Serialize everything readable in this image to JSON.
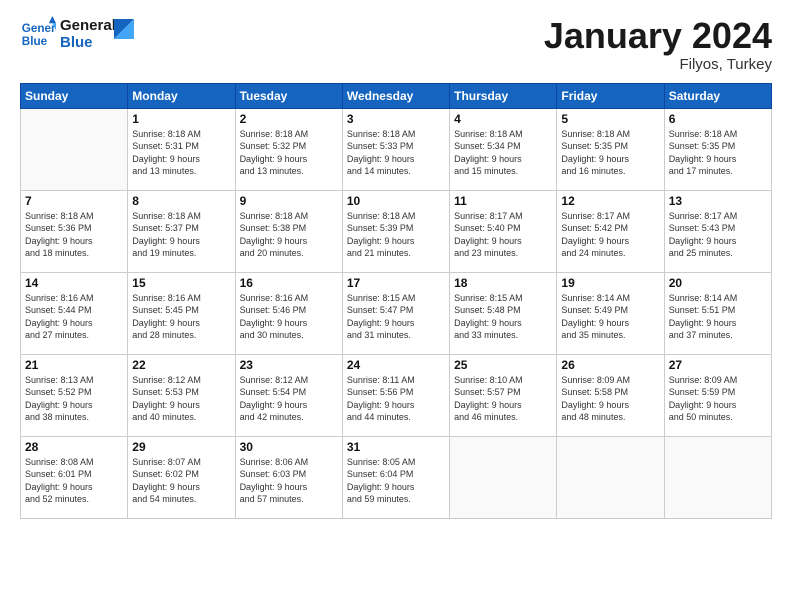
{
  "logo": {
    "line1": "General",
    "line2": "Blue"
  },
  "title": "January 2024",
  "subtitle": "Filyos, Turkey",
  "header_days": [
    "Sunday",
    "Monday",
    "Tuesday",
    "Wednesday",
    "Thursday",
    "Friday",
    "Saturday"
  ],
  "weeks": [
    [
      {
        "day": "",
        "info": ""
      },
      {
        "day": "1",
        "info": "Sunrise: 8:18 AM\nSunset: 5:31 PM\nDaylight: 9 hours\nand 13 minutes."
      },
      {
        "day": "2",
        "info": "Sunrise: 8:18 AM\nSunset: 5:32 PM\nDaylight: 9 hours\nand 13 minutes."
      },
      {
        "day": "3",
        "info": "Sunrise: 8:18 AM\nSunset: 5:33 PM\nDaylight: 9 hours\nand 14 minutes."
      },
      {
        "day": "4",
        "info": "Sunrise: 8:18 AM\nSunset: 5:34 PM\nDaylight: 9 hours\nand 15 minutes."
      },
      {
        "day": "5",
        "info": "Sunrise: 8:18 AM\nSunset: 5:35 PM\nDaylight: 9 hours\nand 16 minutes."
      },
      {
        "day": "6",
        "info": "Sunrise: 8:18 AM\nSunset: 5:35 PM\nDaylight: 9 hours\nand 17 minutes."
      }
    ],
    [
      {
        "day": "7",
        "info": "Sunrise: 8:18 AM\nSunset: 5:36 PM\nDaylight: 9 hours\nand 18 minutes."
      },
      {
        "day": "8",
        "info": "Sunrise: 8:18 AM\nSunset: 5:37 PM\nDaylight: 9 hours\nand 19 minutes."
      },
      {
        "day": "9",
        "info": "Sunrise: 8:18 AM\nSunset: 5:38 PM\nDaylight: 9 hours\nand 20 minutes."
      },
      {
        "day": "10",
        "info": "Sunrise: 8:18 AM\nSunset: 5:39 PM\nDaylight: 9 hours\nand 21 minutes."
      },
      {
        "day": "11",
        "info": "Sunrise: 8:17 AM\nSunset: 5:40 PM\nDaylight: 9 hours\nand 23 minutes."
      },
      {
        "day": "12",
        "info": "Sunrise: 8:17 AM\nSunset: 5:42 PM\nDaylight: 9 hours\nand 24 minutes."
      },
      {
        "day": "13",
        "info": "Sunrise: 8:17 AM\nSunset: 5:43 PM\nDaylight: 9 hours\nand 25 minutes."
      }
    ],
    [
      {
        "day": "14",
        "info": "Sunrise: 8:16 AM\nSunset: 5:44 PM\nDaylight: 9 hours\nand 27 minutes."
      },
      {
        "day": "15",
        "info": "Sunrise: 8:16 AM\nSunset: 5:45 PM\nDaylight: 9 hours\nand 28 minutes."
      },
      {
        "day": "16",
        "info": "Sunrise: 8:16 AM\nSunset: 5:46 PM\nDaylight: 9 hours\nand 30 minutes."
      },
      {
        "day": "17",
        "info": "Sunrise: 8:15 AM\nSunset: 5:47 PM\nDaylight: 9 hours\nand 31 minutes."
      },
      {
        "day": "18",
        "info": "Sunrise: 8:15 AM\nSunset: 5:48 PM\nDaylight: 9 hours\nand 33 minutes."
      },
      {
        "day": "19",
        "info": "Sunrise: 8:14 AM\nSunset: 5:49 PM\nDaylight: 9 hours\nand 35 minutes."
      },
      {
        "day": "20",
        "info": "Sunrise: 8:14 AM\nSunset: 5:51 PM\nDaylight: 9 hours\nand 37 minutes."
      }
    ],
    [
      {
        "day": "21",
        "info": "Sunrise: 8:13 AM\nSunset: 5:52 PM\nDaylight: 9 hours\nand 38 minutes."
      },
      {
        "day": "22",
        "info": "Sunrise: 8:12 AM\nSunset: 5:53 PM\nDaylight: 9 hours\nand 40 minutes."
      },
      {
        "day": "23",
        "info": "Sunrise: 8:12 AM\nSunset: 5:54 PM\nDaylight: 9 hours\nand 42 minutes."
      },
      {
        "day": "24",
        "info": "Sunrise: 8:11 AM\nSunset: 5:56 PM\nDaylight: 9 hours\nand 44 minutes."
      },
      {
        "day": "25",
        "info": "Sunrise: 8:10 AM\nSunset: 5:57 PM\nDaylight: 9 hours\nand 46 minutes."
      },
      {
        "day": "26",
        "info": "Sunrise: 8:09 AM\nSunset: 5:58 PM\nDaylight: 9 hours\nand 48 minutes."
      },
      {
        "day": "27",
        "info": "Sunrise: 8:09 AM\nSunset: 5:59 PM\nDaylight: 9 hours\nand 50 minutes."
      }
    ],
    [
      {
        "day": "28",
        "info": "Sunrise: 8:08 AM\nSunset: 6:01 PM\nDaylight: 9 hours\nand 52 minutes."
      },
      {
        "day": "29",
        "info": "Sunrise: 8:07 AM\nSunset: 6:02 PM\nDaylight: 9 hours\nand 54 minutes."
      },
      {
        "day": "30",
        "info": "Sunrise: 8:06 AM\nSunset: 6:03 PM\nDaylight: 9 hours\nand 57 minutes."
      },
      {
        "day": "31",
        "info": "Sunrise: 8:05 AM\nSunset: 6:04 PM\nDaylight: 9 hours\nand 59 minutes."
      },
      {
        "day": "",
        "info": ""
      },
      {
        "day": "",
        "info": ""
      },
      {
        "day": "",
        "info": ""
      }
    ]
  ]
}
